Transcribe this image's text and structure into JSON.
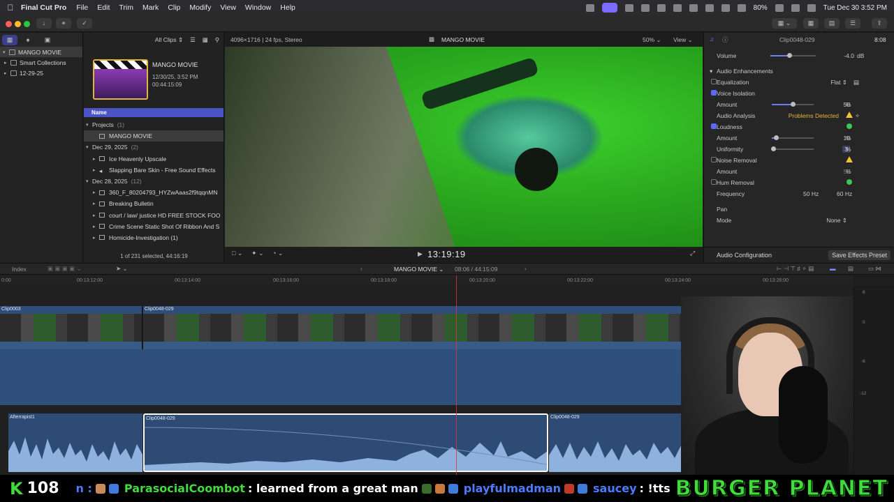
{
  "menubar": {
    "app": "Final Cut Pro",
    "items": [
      "File",
      "Edit",
      "Trim",
      "Mark",
      "Clip",
      "Modify",
      "View",
      "Window",
      "Help"
    ],
    "battery": "80%",
    "datetime": "Tue Dec 30  3:52 PM"
  },
  "browser": {
    "filter": "All Clips",
    "event_title": "MANGO MOVIE",
    "event_date": "12/30/25, 3:52 PM",
    "event_duration": "00:44:15:09",
    "column_name": "Name",
    "status": "1 of 231 selected, 44:16:19",
    "rows": [
      {
        "kind": "group",
        "label": "Projects",
        "count": "(1)"
      },
      {
        "kind": "item",
        "label": "MANGO MOVIE",
        "selected": true
      },
      {
        "kind": "group",
        "label": "Dec 29, 2025",
        "count": "(2)"
      },
      {
        "kind": "item",
        "label": "Ice Heavenly Upscale"
      },
      {
        "kind": "item",
        "label": "Slapping Bare Skin - Free Sound Effects"
      },
      {
        "kind": "group",
        "label": "Dec 28, 2025",
        "count": "(12)"
      },
      {
        "kind": "item",
        "label": "360_F_80204793_HYZwAaas2f9tqqnMN"
      },
      {
        "kind": "item",
        "label": "Breaking Bulletin"
      },
      {
        "kind": "item",
        "label": "court / law/ justice HD FREE STOCK FOO"
      },
      {
        "kind": "item",
        "label": "Crime Scene Static Shot Of Ribbon And S"
      },
      {
        "kind": "item",
        "label": "Homicide-Investigation (1)"
      }
    ]
  },
  "libraries": {
    "root": "MANGO MOVIE",
    "smart": "Smart Collections",
    "event": "12-29-25"
  },
  "viewer": {
    "format": "4096×1716 | 24 fps, Stereo",
    "title": "MANGO MOVIE",
    "zoom": "50%",
    "view": "View",
    "timecode": "13:19:19"
  },
  "inspector": {
    "clip": "Clip0048-029",
    "duration": "8:08",
    "volume_label": "Volume",
    "volume_value": "-4.0",
    "volume_unit": "dB",
    "audio_enh": "Audio Enhancements",
    "eq_label": "Equalization",
    "eq_value": "Flat",
    "voice_iso": "Voice Isolation",
    "amount": "Amount",
    "voice_amount": "50",
    "analysis_label": "Audio Analysis",
    "analysis_value": "Problems Detected",
    "loudness": "Loudness",
    "loud_amount": "10",
    "uniformity": "Uniformity",
    "uniform_value": "3",
    "noise": "Noise Removal",
    "noise_amount": "50",
    "hum": "Hum Removal",
    "freq_label": "Frequency",
    "freq_a": "50",
    "freq_b": "60",
    "hz": "Hz",
    "pct": "%",
    "pan": "Pan",
    "mode_label": "Mode",
    "mode_value": "None",
    "audio_config": "Audio Configuration",
    "save_preset": "Save Effects Preset",
    "levels": {
      "volume": 0.42,
      "voice": 0.5,
      "loud": 0.1,
      "uniform": 0.03
    }
  },
  "timeline": {
    "index": "Index",
    "project": "MANGO MOVIE",
    "position": "08:06 / 44:15:09",
    "ruler": [
      "0:00",
      "00:13:12:00",
      "00:13:14:00",
      "00:13:16:00",
      "00:13:18:00",
      "00:13:20:00",
      "00:13:22:00",
      "00:13:24:00",
      "00:13:26:00"
    ],
    "clips": {
      "c1": "Clip0003",
      "c2": "Clip0048-029",
      "a1": "Afterrapist1",
      "a2": "Clip0048-029",
      "a3": "Clip0048-029"
    },
    "meter_scale": [
      "6",
      "0",
      "-6",
      "-12"
    ]
  },
  "chat": {
    "count": "108",
    "msgs": [
      {
        "user": "n :",
        "color": "#4b7bff",
        "text": ""
      },
      {
        "user": "ParasocialCoombot",
        "color": "#3fdc3a",
        "text": ": learned from a great man"
      },
      {
        "user": "playfulmadman",
        "color": "#4b7bff",
        "text": ":"
      },
      {
        "user": "saucey",
        "color": "#4b7bff",
        "text": ": !tts"
      }
    ],
    "brand": "BURGER PLANET"
  }
}
